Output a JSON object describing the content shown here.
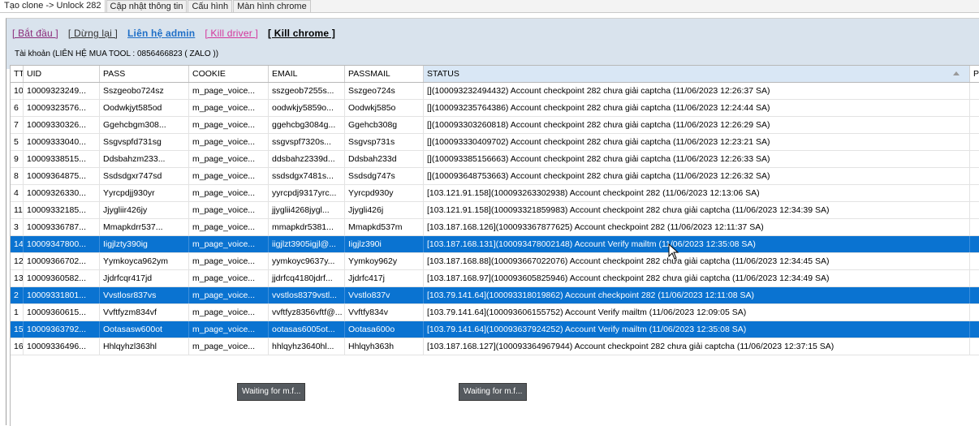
{
  "tabs": [
    {
      "label": "Tạo clone -> Unlock 282",
      "active": true
    },
    {
      "label": "Cập nhật thông tin",
      "active": false
    },
    {
      "label": "Cấu hình",
      "active": false
    },
    {
      "label": "Màn hình chrome",
      "active": false
    }
  ],
  "toolbar": {
    "start": "[ Bắt đầu ]",
    "stop": "[ Dừng lại ]",
    "admin": "Liên hệ admin",
    "kill_driver": "[ Kill driver ]",
    "kill_chrome": "[ Kill chrome ]"
  },
  "account_label": "Tài khoản (LIÊN HỆ MUA TOOL : 0856466823 ( ZALO ))",
  "table": {
    "columns": [
      "TT",
      "UID",
      "PASS",
      "COOKIE",
      "EMAIL",
      "PASSMAIL",
      "STATUS",
      "P"
    ],
    "rows": [
      {
        "tt": "10",
        "uid": "10009323249...",
        "pass": "Sszgeobo724sz",
        "cookie": "m_page_voice...",
        "email": "sszgeob7255s...",
        "passmail": "Sszgeo724s",
        "status": "[](100093232494432) Account checkpoint 282 chưa giải captcha (11/06/2023 12:26:37 SA)",
        "selected": false
      },
      {
        "tt": "6",
        "uid": "10009323576...",
        "pass": "Oodwkjyt585od",
        "cookie": "m_page_voice...",
        "email": "oodwkjy5859o...",
        "passmail": "Oodwkj585o",
        "status": "[](100093235764386) Account checkpoint 282 chưa giải captcha (11/06/2023 12:24:44 SA)",
        "selected": false
      },
      {
        "tt": "7",
        "uid": "10009330326...",
        "pass": "Ggehcbgm308...",
        "cookie": "m_page_voice...",
        "email": "ggehcbg3084g...",
        "passmail": "Ggehcb308g",
        "status": "[](100093303260818) Account checkpoint 282 chưa giải captcha (11/06/2023 12:26:29 SA)",
        "selected": false
      },
      {
        "tt": "5",
        "uid": "10009333040...",
        "pass": "Ssgvspfd731sg",
        "cookie": "m_page_voice...",
        "email": "ssgvspf7320s...",
        "passmail": "Ssgvsp731s",
        "status": "[](100093330409702) Account checkpoint 282 chưa giải captcha (11/06/2023 12:23:21 SA)",
        "selected": false
      },
      {
        "tt": "9",
        "uid": "10009338515...",
        "pass": "Ddsbahzm233...",
        "cookie": "m_page_voice...",
        "email": "ddsbahz2339d...",
        "passmail": "Ddsbah233d",
        "status": "[](100093385156663) Account checkpoint 282 chưa giải captcha (11/06/2023 12:26:33 SA)",
        "selected": false
      },
      {
        "tt": "8",
        "uid": "10009364875...",
        "pass": "Ssdsdgxr747sd",
        "cookie": "m_page_voice...",
        "email": "ssdsdgx7481s...",
        "passmail": "Ssdsdg747s",
        "status": "[](100093648753663) Account checkpoint 282 chưa giải captcha (11/06/2023 12:26:32 SA)",
        "selected": false
      },
      {
        "tt": "4",
        "uid": "10009326330...",
        "pass": "Yyrcpdjj930yr",
        "cookie": "m_page_voice...",
        "email": "yyrcpdj9317yrc...",
        "passmail": "Yyrcpd930y",
        "status": "[103.121.91.158](100093263302938) Account checkpoint 282 (11/06/2023 12:13:06 SA)",
        "selected": false
      },
      {
        "tt": "11",
        "uid": "10009332185...",
        "pass": "Jjygliir426jy",
        "cookie": "m_page_voice...",
        "email": "jjyglii4268jygl...",
        "passmail": "Jjygli426j",
        "status": "[103.121.91.158](100093321859983) Account checkpoint 282 chưa giải captcha (11/06/2023 12:34:39 SA)",
        "selected": false
      },
      {
        "tt": "3",
        "uid": "10009336787...",
        "pass": "Mmapkdrr537...",
        "cookie": "m_page_voice...",
        "email": "mmapkdr5381...",
        "passmail": "Mmapkd537m",
        "status": "[103.187.168.126](100093367877625) Account checkpoint 282 (11/06/2023 12:11:37 SA)",
        "selected": false
      },
      {
        "tt": "14",
        "uid": "10009347800...",
        "pass": "Iigjlzty390ig",
        "cookie": "m_page_voice...",
        "email": "iigjlzt3905igjl@...",
        "passmail": "Iigjlz390i",
        "status": "[103.187.168.131](100093478002148) Account Verify mailtm (11/06/2023 12:35:08 SA)",
        "selected": true
      },
      {
        "tt": "12",
        "uid": "10009366702...",
        "pass": "Yymkoyca962ym",
        "cookie": "m_page_voice...",
        "email": "yymkoyc9637y...",
        "passmail": "Yymkoy962y",
        "status": "[103.187.168.88](100093667022076) Account checkpoint 282 chưa giải captcha (11/06/2023 12:34:45 SA)",
        "selected": false
      },
      {
        "tt": "13",
        "uid": "10009360582...",
        "pass": "Jjdrfcqr417jd",
        "cookie": "m_page_voice...",
        "email": "jjdrfcq4180jdrf...",
        "passmail": "Jjdrfc417j",
        "status": "[103.187.168.97](100093605825946) Account checkpoint 282 chưa giải captcha (11/06/2023 12:34:49 SA)",
        "selected": false
      },
      {
        "tt": "2",
        "uid": "10009331801...",
        "pass": "Vvstlosr837vs",
        "cookie": "m_page_voice...",
        "email": "vvstlos8379vstl...",
        "passmail": "Vvstlo837v",
        "status": "[103.79.141.64](100093318019862) Account checkpoint 282 (11/06/2023 12:11:08 SA)",
        "selected": true
      },
      {
        "tt": "1",
        "uid": "10009360615...",
        "pass": "Vvftfyzm834vf",
        "cookie": "m_page_voice...",
        "email": "vvftfyz8356vftf@...",
        "passmail": "Vvftfy834v",
        "status": "[103.79.141.64](100093606155752) Account Verify mailtm (11/06/2023 12:09:05 SA)",
        "selected": false
      },
      {
        "tt": "15",
        "uid": "10009363792...",
        "pass": "Ootasasw600ot",
        "cookie": "m_page_voice...",
        "email": "ootasas6005ot...",
        "passmail": "Ootasa600o",
        "status": "[103.79.141.64](100093637924252) Account Verify mailtm (11/06/2023 12:35:08 SA)",
        "selected": true
      },
      {
        "tt": "16",
        "uid": "10009336496...",
        "pass": "Hhlqyhzl363hl",
        "cookie": "m_page_voice...",
        "email": "hhlqyhz3640hl...",
        "passmail": "Hhlqyh363h",
        "status": "[103.187.168.127](100093364967944) Account checkpoint 282 chưa giải captcha (11/06/2023 12:37:15 SA)",
        "selected": false
      }
    ]
  },
  "waiting": [
    {
      "label": "Waiting for m.f..."
    },
    {
      "label": "Waiting for m.f..."
    }
  ],
  "colors": {
    "selection": "#0a73d1",
    "header_band": "#d9e3ed"
  }
}
